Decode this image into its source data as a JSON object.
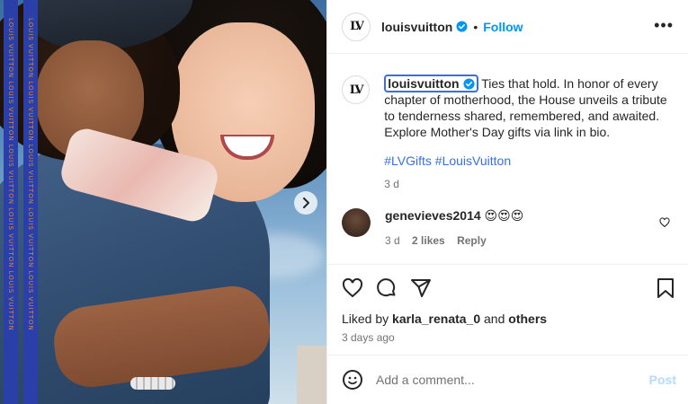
{
  "post": {
    "image_alt": "Louis Vuitton Mother's Day campaign photo",
    "strap_text": "LOUIS VUITTON LOUIS VUITTON LOUIS VUITTON LOUIS VUITTON LOUIS VUITTON"
  },
  "header": {
    "avatar_text": "LV",
    "username": "louisvuitton",
    "separator": "•",
    "follow_label": "Follow",
    "more_label": "•••"
  },
  "caption": {
    "username": "louisvuitton",
    "text": "Ties that hold. In honor of every chapter of motherhood, the House unveils a tribute to tenderness shared, remembered, and awaited. Explore Mother's Day gifts via link in bio.",
    "hashtags": "#LVGifts #LouisVuitton",
    "time": "3 d"
  },
  "comment": {
    "username": "genevieves2014",
    "text": "😍😍😍",
    "time": "3 d",
    "likes": "2 likes",
    "reply_label": "Reply"
  },
  "likes": {
    "prefix": "Liked by",
    "user": "karla_renata_0",
    "conj": "and",
    "others": "others"
  },
  "date": "3 days ago",
  "add_comment": {
    "placeholder": "Add a comment...",
    "post_label": "Post"
  },
  "colors": {
    "accent": "#0095f6",
    "link": "#3a6ee8",
    "post_disabled": "#b3dbff"
  }
}
